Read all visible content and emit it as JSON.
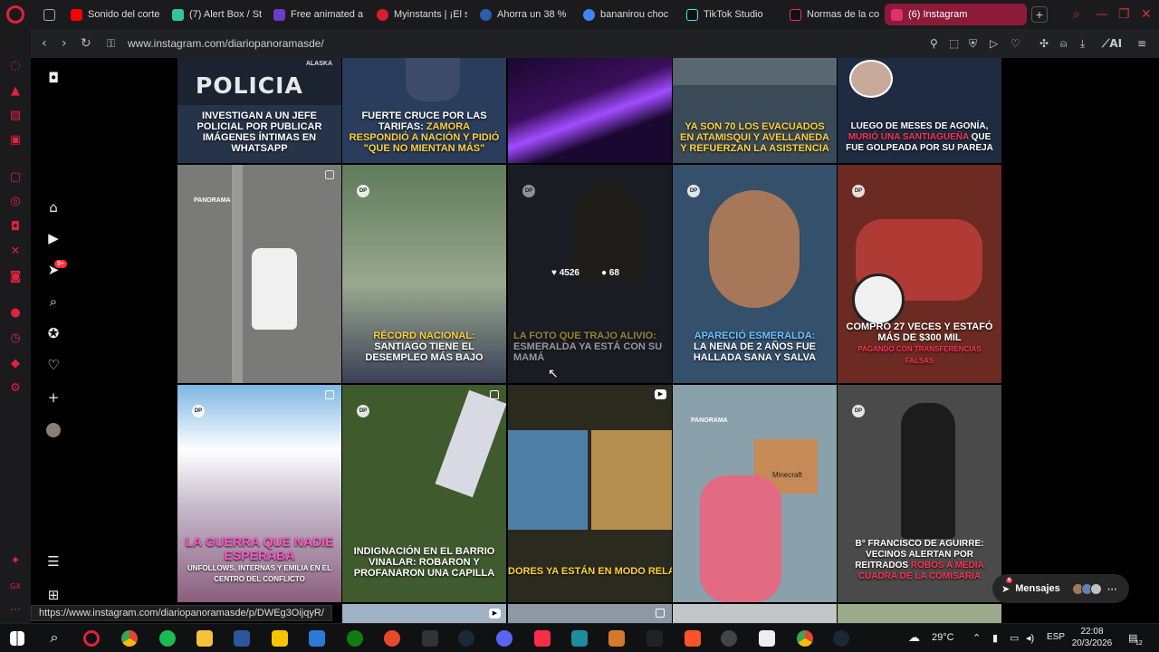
{
  "tabs": [
    {
      "title": "Sonido del corte",
      "color": "#ff0000"
    },
    {
      "title": "(7) Alert Box / St",
      "color": "#31c3a2"
    },
    {
      "title": "Free animated a",
      "color": "#6b3cc9"
    },
    {
      "title": "Myinstants | ¡El s",
      "color": "#d81e2a"
    },
    {
      "title": "Ahorra un 38 %",
      "color": "#2a5ea8"
    },
    {
      "title": "bananirou choc",
      "color": "#4285f4"
    },
    {
      "title": "TikTok Studio",
      "color": "#111111"
    },
    {
      "title": "Normas de la co",
      "color": "#111111"
    },
    {
      "title": "(6) Instagram",
      "color": "#e1306c"
    }
  ],
  "url": "www.instagram.com/diariopanoramasde/",
  "ig_nav": {
    "notification_badge": "9+"
  },
  "posts": [
    {
      "caption": "INVESTIGAN A UN JEFE POLICIAL POR PUBLICAR IMÁGENES ÍNTIMAS EN WHATSAPP",
      "sign_text": "POLICIA",
      "sign_sub": "ALASKA",
      "bg": "#26344a"
    },
    {
      "caption_a": "FUERTE CRUCE POR LAS TARIFAS:",
      "caption_b": "ZAMORA RESPONDIÓ A NACIÓN Y PIDIÓ \"QUE NO MIENTAN MÁS\"",
      "bg": "#2a3d5c"
    },
    {
      "caption": "",
      "bg": "#2a0b3a"
    },
    {
      "caption": "YA SON 70 LOS EVACUADOS EN ATAMISQUI Y AVELLANEDA Y REFUERZAN LA ASISTENCIA",
      "bg": "#3a4a58"
    },
    {
      "caption_a": "LUEGO DE MESES DE AGONÍA,",
      "caption_red": "MURIÓ UNA SANTIAGUEÑA",
      "caption_b": "QUE FUE GOLPEADA POR SU PAREJA",
      "bg": "#1e2b40"
    },
    {
      "caption": "",
      "logo_text": "PANORAMA",
      "bg": "#7a7a78"
    },
    {
      "caption_hl": "RÉCORD NACIONAL:",
      "caption_b": "SANTIAGO TIENE EL DESEMPLEO MÁS BAJO",
      "bg": "#5a6f5a"
    },
    {
      "caption_a": "LA FOTO QUE TRAJO ALIVIO:",
      "caption_b": "ESMERALDA YA ESTÁ CON SU MAMÁ",
      "likes": "4526",
      "comments": "68",
      "bg": "#2e3440"
    },
    {
      "caption_hl": "APARECIÓ ESMERALDA:",
      "caption_b": "LA NENA DE 2 AÑOS FUE HALLADA SANA Y SALVA",
      "bg": "#34506b"
    },
    {
      "caption_a": "COMPRÓ 27 VECES Y ESTAFÓ MÁS DE $300 MIL",
      "caption_red": "PAGANDO CON TRANSFERENCIAS FALSAS",
      "bg": "#6b2a22"
    },
    {
      "caption_hl": "LA GUERRA QUE NADIE ESPERABA",
      "caption_b": "UNFOLLOWS, INTERNAS Y EMILIA EN EL CENTRO DEL CONFLICTO",
      "bg": "#b7a9bd"
    },
    {
      "caption": "INDIGNACIÓN EN EL BARRIO VINALAR: ROBARON Y PROFANARON UNA CAPILLA",
      "bg": "#3f5a2c"
    },
    {
      "caption_hl": "DORES YA ESTÁN EN MODO RELAX: AI",
      "bg": "#2b2a1e"
    },
    {
      "caption": "",
      "logo_text": "PANORAMA",
      "box_text": "Minecraft",
      "bg": "#8aa0ab"
    },
    {
      "caption_a": "B° FRANCISCO DE AGUIRRE: VECINOS ALERTAN POR REITRADOS",
      "caption_red": "ROBOS A MEDIA CUADRA DE LA COMISARÍA",
      "bg": "#4a4a4a"
    }
  ],
  "messages": {
    "label": "Mensajes",
    "badge": "6"
  },
  "status_url": "https://www.instagram.com/diariopanoramasde/p/DWEg3OijqyR/",
  "taskbar": {
    "temperature": "29°C",
    "language": "ESP",
    "time": "22:08",
    "date": "20/3/2026",
    "notif_count": "12"
  }
}
